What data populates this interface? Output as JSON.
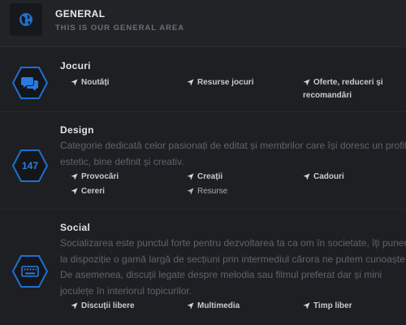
{
  "category": {
    "title": "GENERAL",
    "subtitle": "THIS IS OUR GENERAL AREA",
    "icon": "globe-icon"
  },
  "forums": [
    {
      "title": "Jocuri",
      "icon": "chat-bubbles-icon",
      "description_lines": [],
      "subforums": [
        {
          "label": "Noutăți"
        },
        {
          "label": "Resurse jocuri"
        },
        {
          "label": "Oferte, reduceri și",
          "label_cont": "recomandări"
        }
      ]
    },
    {
      "title": "Design",
      "icon_text": "147",
      "description_lines": [
        "Categorie dedicată celor pasionați de editat și membrilor care își doresc un profil",
        "estetic, bine definit și creativ."
      ],
      "subforums": [
        {
          "label": "Provocări"
        },
        {
          "label": "Creații"
        },
        {
          "label": "Cadouri"
        },
        {
          "label": "Cereri"
        },
        {
          "label": "Resurse"
        }
      ]
    },
    {
      "title": "Social",
      "icon": "keyboard-icon",
      "description_lines": [
        "Socializarea este punctul forte pentru dezvoltarea ta ca om în societate, îți punem",
        "la dispoziție o gamă largă de secțiuni prin intermediul cărora ne putem cunoaște.",
        "De asemenea, discuții legate despre melodia sau filmul preferat dar și mini",
        "joculețe în interiorul topicurilor."
      ],
      "subforums": [
        {
          "label": "Discuții libere"
        },
        {
          "label": "Multimedia"
        },
        {
          "label": "Timp liber"
        }
      ]
    }
  ],
  "colors": {
    "background": "#1e1f22",
    "header_bg": "#222326",
    "accent_blue": "#1f6fcf",
    "title_text": "#e2e3e5",
    "muted_text": "#5f636b"
  }
}
